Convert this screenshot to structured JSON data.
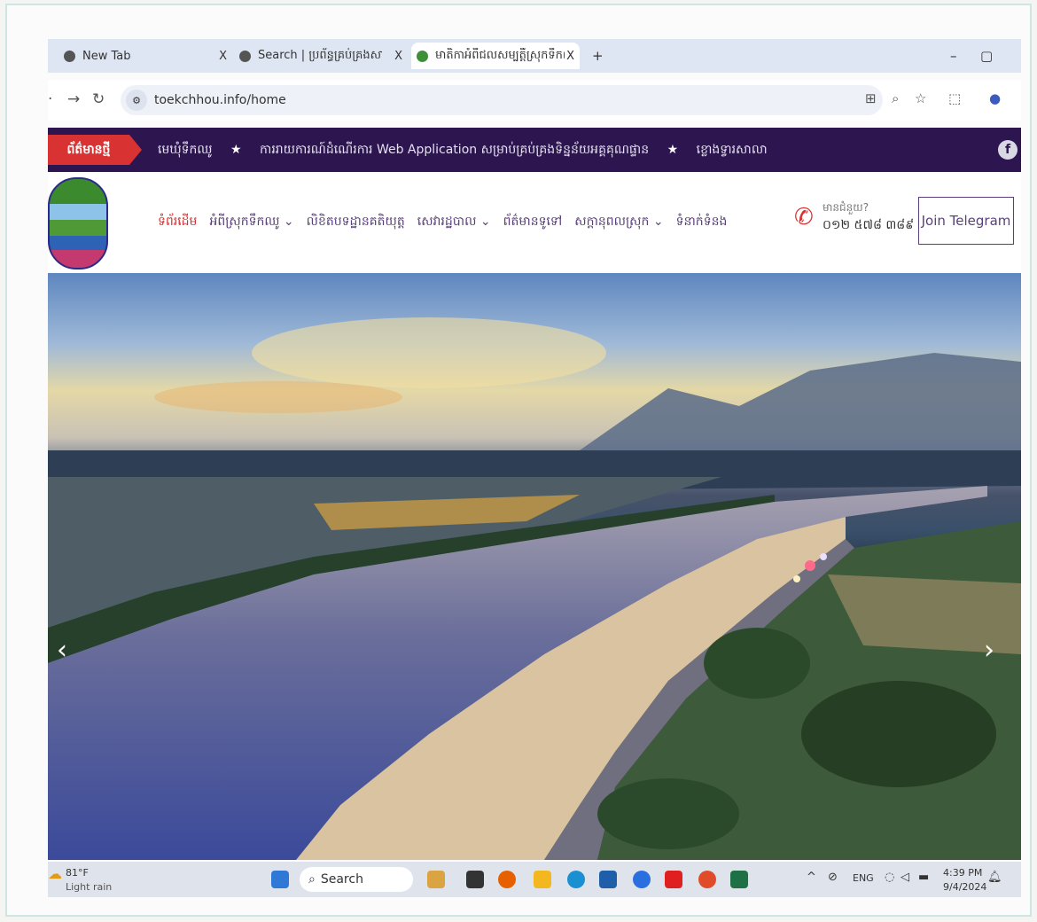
{
  "browser": {
    "tabs": [
      {
        "label": "New Tab",
        "active": false
      },
      {
        "label": "Search | ប្រព័ន្ធគ្រប់គ្រងសាលារៀ",
        "active": false
      },
      {
        "label": "មាតិកាអំពីជលសម្បត្តិ៍ស្រុកទឹកឈូ",
        "active": true
      }
    ],
    "new_tab": "+",
    "close": "X",
    "url": "toekchhou.info/home",
    "window_controls": [
      "–",
      "▢",
      "✕"
    ]
  },
  "news_bar": {
    "badge": "ព័ត៌មានថ្មី",
    "items": [
      "មេឃុំទឹកឈូ",
      "ការរាយការណ៍ដំណើរការ Web Application សម្រាប់គ្រប់គ្រងទិន្នន័យអគ្គគុណផ្ទាន",
      "ខ្លោងទ្វារសាលា"
    ],
    "facebook": "f"
  },
  "header": {
    "menu": [
      {
        "label": "ទំព័រដើម",
        "dropdown": false,
        "active": true
      },
      {
        "label": "អំពីស្រុកទឹកឈូ",
        "dropdown": true,
        "active": false
      },
      {
        "label": "លិខិតបទដ្ឋានគតិយុត្ត",
        "dropdown": false,
        "active": false
      },
      {
        "label": "សេវារដ្ឋបាល",
        "dropdown": true,
        "active": false
      },
      {
        "label": "ព័ត៌មានទូទៅ",
        "dropdown": false,
        "active": false
      },
      {
        "label": "សក្ដានុពលស្រុក",
        "dropdown": true,
        "active": false
      },
      {
        "label": "ទំនាក់ទំនង",
        "dropdown": false,
        "active": false
      }
    ],
    "phone_question": "មានជំនួយ?",
    "phone_number": "០១២ ៥៧៨ ៣៨៩",
    "telegram": "Join Telegram"
  },
  "taskbar": {
    "weather_temp": "81°F",
    "weather_desc": "Light rain",
    "search": "Search",
    "lang": "ENG",
    "time": "4:39 PM",
    "date": "9/4/2024"
  },
  "colors": {
    "nav_bg": "#2d1550",
    "accent_red": "#d83232",
    "menu_text": "#5a3f7a"
  }
}
